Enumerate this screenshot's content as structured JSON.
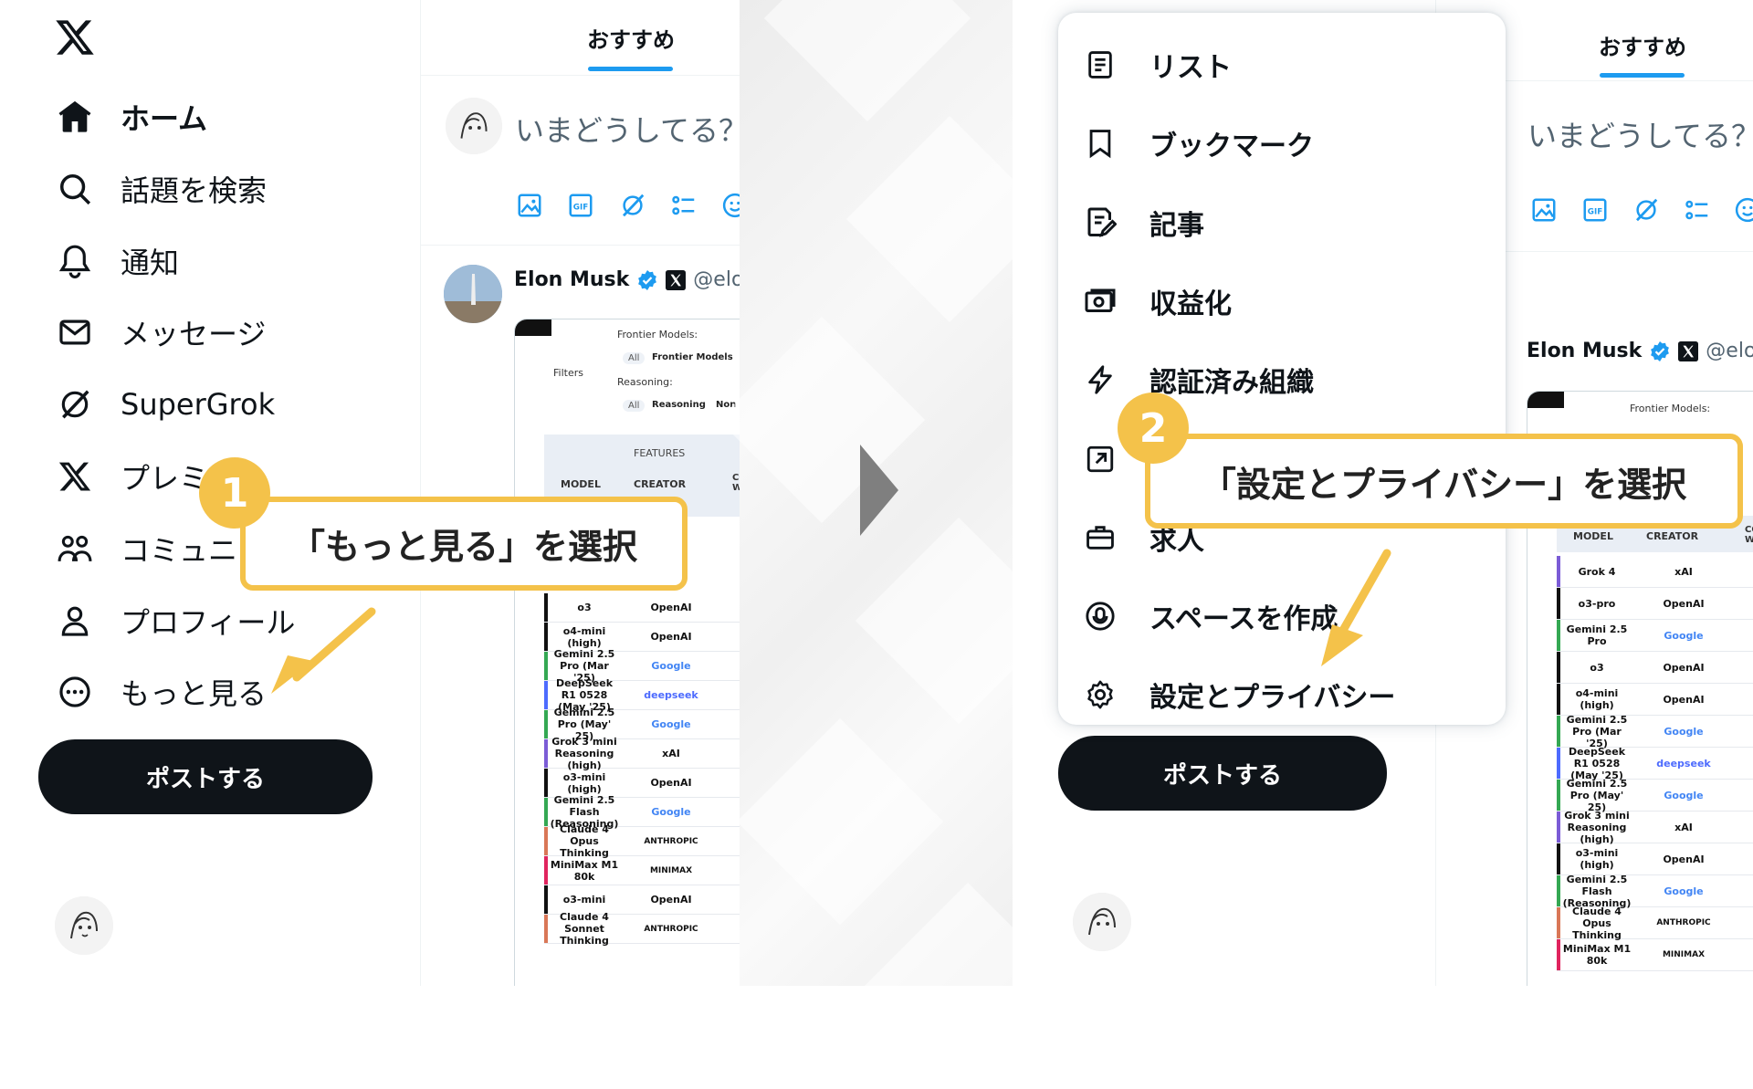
{
  "colors": {
    "accent": "#1d9bf0",
    "callout": "#f4c24a",
    "text": "#0f1419",
    "muted": "#536471",
    "arrow_gray": "#7f7f7f"
  },
  "left": {
    "logo_icon": "x-logo-icon",
    "nav": [
      {
        "label": "ホーム",
        "icon": "home-icon"
      },
      {
        "label": "話題を検索",
        "icon": "search-icon"
      },
      {
        "label": "通知",
        "icon": "bell-icon"
      },
      {
        "label": "メッセージ",
        "icon": "mail-icon"
      },
      {
        "label": "SuperGrok",
        "icon": "grok-icon"
      },
      {
        "label": "プレミ",
        "icon": "x-icon"
      },
      {
        "label": "コミュニ",
        "icon": "communities-icon"
      },
      {
        "label": "プロフィール",
        "icon": "person-icon"
      },
      {
        "label": "もっと見る",
        "icon": "more-circle-icon"
      }
    ],
    "post_button": "ポストする",
    "tab": "おすすめ",
    "compose_placeholder": "いまどうしてる？",
    "tweet": {
      "author": "Elon Musk",
      "handle": "@elon"
    },
    "callout": {
      "step": "1",
      "text": "「もっと見る」を選択"
    }
  },
  "table": {
    "filter_label": "Filters",
    "frontier_label": "Frontier Models:",
    "frontier_chips": [
      "All",
      "Frontier Models"
    ],
    "reasoning_label": "Reasoning:",
    "reasoning_chips": [
      "All",
      "Reasoning",
      "Non R"
    ],
    "features_label": "FEATURES",
    "headers": [
      "MODEL",
      "CREATOR",
      "CONT WIND"
    ],
    "rows_left": [
      {
        "model": "o3",
        "creator": "OpenAI",
        "color": "#111111"
      },
      {
        "model": "o4-mini (high)",
        "creator": "OpenAI",
        "color": "#111111"
      },
      {
        "model": "Gemini 2.5 Pro (Mar '25)",
        "creator": "Google",
        "color": "#34a853"
      },
      {
        "model": "DeepSeek R1 0528 (May '25)",
        "creator": "deepseek",
        "color": "#4d6bfe"
      },
      {
        "model": "Gemini 2.5 Pro (May' 25)",
        "creator": "Google",
        "color": "#34a853"
      },
      {
        "model": "Grok 3 mini Reasoning (high)",
        "creator": "xAI",
        "color": "#7b5cd6"
      },
      {
        "model": "o3-mini (high)",
        "creator": "OpenAI",
        "color": "#111111"
      },
      {
        "model": "Gemini 2.5 Flash (Reasoning)",
        "creator": "Google",
        "color": "#34a853"
      },
      {
        "model": "Claude 4 Opus Thinking",
        "creator": "ANTHROPIC",
        "color": "#d97757"
      },
      {
        "model": "MiniMax M1 80k",
        "creator": "MINIMAX",
        "color": "#e0245e"
      },
      {
        "model": "o3-mini",
        "creator": "OpenAI",
        "color": "#111111"
      },
      {
        "model": "Claude 4 Sonnet Thinking",
        "creator": "ANTHROPIC",
        "color": "#d97757"
      }
    ],
    "rows_right": [
      {
        "model": "Grok 4",
        "creator": "xAI",
        "color": "#7b5cd6"
      },
      {
        "model": "o3-pro",
        "creator": "OpenAI",
        "color": "#111111"
      },
      {
        "model": "Gemini 2.5 Pro",
        "creator": "Google",
        "color": "#34a853"
      },
      {
        "model": "o3",
        "creator": "OpenAI",
        "color": "#111111"
      },
      {
        "model": "o4-mini (high)",
        "creator": "OpenAI",
        "color": "#111111"
      },
      {
        "model": "Gemini 2.5 Pro (Mar '25)",
        "creator": "Google",
        "color": "#34a853"
      },
      {
        "model": "DeepSeek R1 0528 (May '25)",
        "creator": "deepseek",
        "color": "#4d6bfe"
      },
      {
        "model": "Gemini 2.5 Pro (May' 25)",
        "creator": "Google",
        "color": "#34a853"
      },
      {
        "model": "Grok 3 mini Reasoning (high)",
        "creator": "xAI",
        "color": "#7b5cd6"
      },
      {
        "model": "o3-mini (high)",
        "creator": "OpenAI",
        "color": "#111111"
      },
      {
        "model": "Gemini 2.5 Flash (Reasoning)",
        "creator": "Google",
        "color": "#34a853"
      },
      {
        "model": "Claude 4 Opus Thinking",
        "creator": "ANTHROPIC",
        "color": "#d97757"
      },
      {
        "model": "MiniMax M1 80k",
        "creator": "MINIMAX",
        "color": "#e0245e"
      }
    ]
  },
  "right": {
    "menu": [
      {
        "label": "リスト",
        "icon": "list-icon"
      },
      {
        "label": "ブックマーク",
        "icon": "bookmark-icon"
      },
      {
        "label": "記事",
        "icon": "article-icon"
      },
      {
        "label": "収益化",
        "icon": "monetization-icon"
      },
      {
        "label": "認証済み組織",
        "icon": "lightning-icon"
      },
      {
        "label": "",
        "icon": "external-link-icon"
      },
      {
        "label": "求人",
        "icon": "briefcase-icon"
      },
      {
        "label": "スペースを作成",
        "icon": "spaces-icon"
      },
      {
        "label": "設定とプライバシー",
        "icon": "gear-icon"
      }
    ],
    "post_button": "ポストする",
    "tab": "おすすめ",
    "compose_placeholder": "いまどうしてる？",
    "tweet": {
      "author": "Elon Musk",
      "handle": "@elon"
    },
    "callout": {
      "step": "2",
      "text": "「設定とプライバシー」を選択"
    }
  }
}
